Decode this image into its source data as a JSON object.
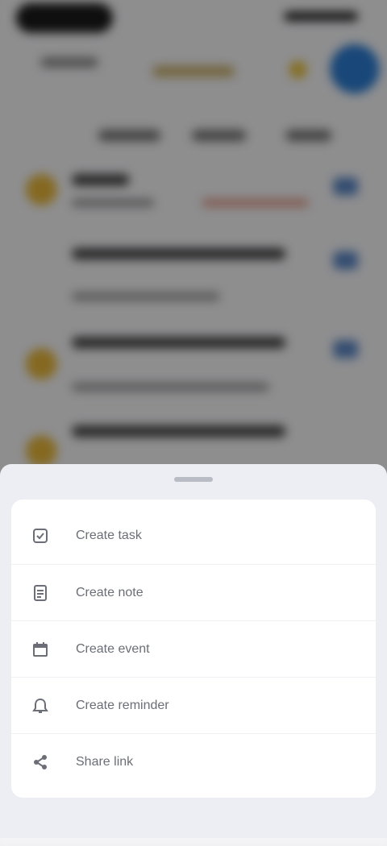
{
  "action_sheet": {
    "items": [
      {
        "label": "Create task",
        "icon": "task-icon"
      },
      {
        "label": "Create note",
        "icon": "note-icon"
      },
      {
        "label": "Create event",
        "icon": "calendar-icon"
      },
      {
        "label": "Create reminder",
        "icon": "reminder-icon"
      },
      {
        "label": "Share link",
        "icon": "share-icon"
      }
    ]
  },
  "colors": {
    "accent": "#2b7bd0",
    "star": "#e6c040",
    "sheet_background": "#eceef3",
    "card_background": "#ffffff"
  }
}
